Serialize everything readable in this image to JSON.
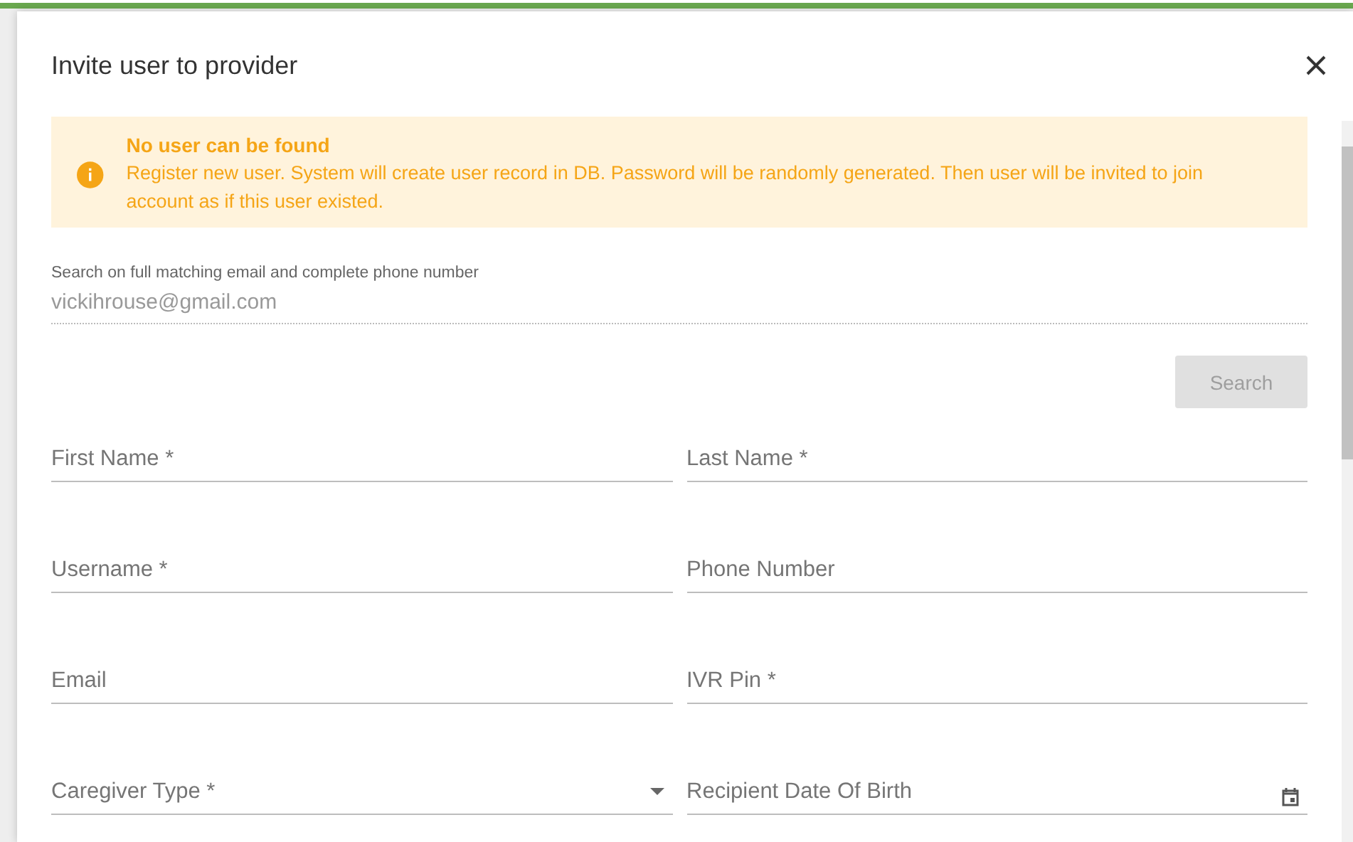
{
  "dialog": {
    "title": "Invite user to provider"
  },
  "alert": {
    "title": "No user can be found",
    "message": "Register new user. System will create user record in DB. Password will be randomly generated. Then user will be invited to join account as if this user existed."
  },
  "search": {
    "label": "Search on full matching email and complete phone number",
    "value": "vickihrouse@gmail.com",
    "button": {
      "label": "Search",
      "disabled": true
    }
  },
  "fields": [
    {
      "placeholder": "First Name *",
      "kind": "text"
    },
    {
      "placeholder": "Last Name *",
      "kind": "text"
    },
    {
      "placeholder": "Username *",
      "kind": "text"
    },
    {
      "placeholder": "Phone Number",
      "kind": "text"
    },
    {
      "placeholder": "Email",
      "kind": "text"
    },
    {
      "placeholder": "IVR Pin *",
      "kind": "text"
    },
    {
      "placeholder": "Caregiver Type *",
      "kind": "select"
    },
    {
      "placeholder": "Recipient Date Of Birth",
      "kind": "date"
    }
  ]
}
